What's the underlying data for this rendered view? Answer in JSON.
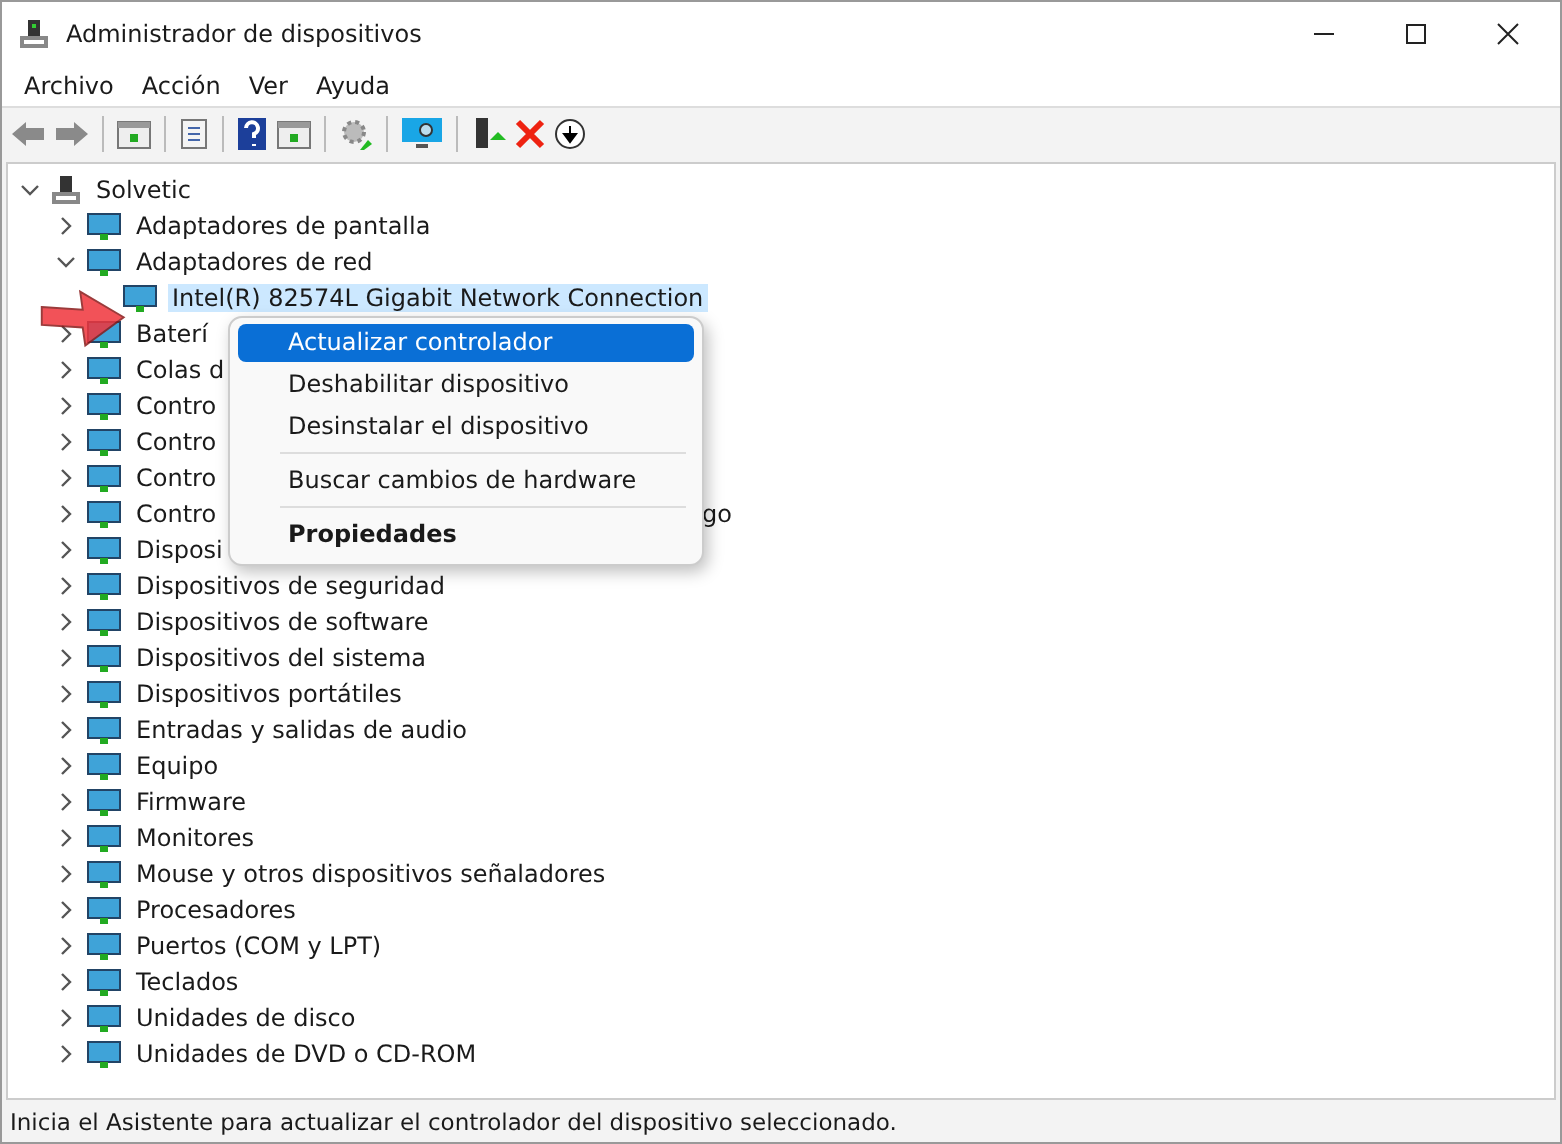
{
  "window": {
    "title": "Administrador de dispositivos"
  },
  "menu": [
    "Archivo",
    "Acción",
    "Ver",
    "Ayuda"
  ],
  "tree": {
    "label": "Solvetic",
    "expanded": true,
    "children": [
      {
        "label": "Adaptadores de pantalla",
        "expanded": false
      },
      {
        "label": "Adaptadores de red",
        "expanded": true,
        "children": [
          {
            "label": "Intel(R) 82574L Gigabit Network Connection",
            "selected": true
          }
        ]
      },
      {
        "label": "Baterí",
        "expanded": false
      },
      {
        "label": "Colas d",
        "expanded": false
      },
      {
        "label": "Contro",
        "expanded": false
      },
      {
        "label": "Contro",
        "expanded": false
      },
      {
        "label": "Contro",
        "expanded": false
      },
      {
        "label": "Contro",
        "expanded": false,
        "tail": "go"
      },
      {
        "label": "Disposi",
        "expanded": false
      },
      {
        "label": "Dispositivos de seguridad",
        "expanded": false
      },
      {
        "label": "Dispositivos de software",
        "expanded": false
      },
      {
        "label": "Dispositivos del sistema",
        "expanded": false
      },
      {
        "label": "Dispositivos portátiles",
        "expanded": false
      },
      {
        "label": "Entradas y salidas de audio",
        "expanded": false
      },
      {
        "label": "Equipo",
        "expanded": false
      },
      {
        "label": "Firmware",
        "expanded": false
      },
      {
        "label": "Monitores",
        "expanded": false
      },
      {
        "label": "Mouse y otros dispositivos señaladores",
        "expanded": false
      },
      {
        "label": "Procesadores",
        "expanded": false
      },
      {
        "label": "Puertos (COM y LPT)",
        "expanded": false
      },
      {
        "label": "Teclados",
        "expanded": false
      },
      {
        "label": "Unidades de disco",
        "expanded": false
      },
      {
        "label": "Unidades de DVD o CD-ROM",
        "expanded": false
      }
    ]
  },
  "context_menu": [
    {
      "label": "Actualizar controlador",
      "selected": true,
      "bold": false
    },
    {
      "label": "Deshabilitar dispositivo",
      "selected": false,
      "bold": false
    },
    {
      "label": "Desinstalar el dispositivo",
      "selected": false,
      "bold": false,
      "separator_after": true
    },
    {
      "label": "Buscar cambios de hardware",
      "selected": false,
      "bold": false,
      "separator_after": true
    },
    {
      "label": "Propiedades",
      "selected": false,
      "bold": true
    }
  ],
  "status_bar": "Inicia el Asistente para actualizar el controlador del dispositivo seleccionado."
}
